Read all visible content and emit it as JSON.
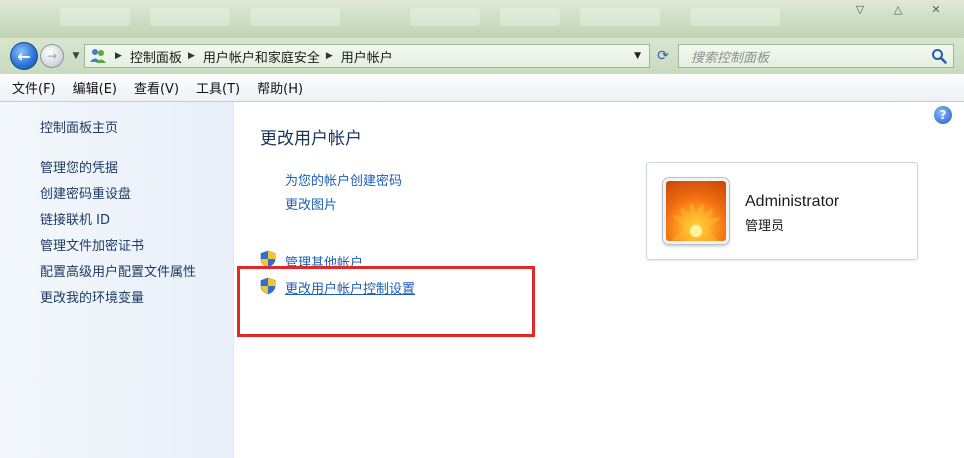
{
  "address_bar": {
    "breadcrumbs": [
      "控制面板",
      "用户帐户和家庭安全",
      "用户帐户"
    ],
    "search_placeholder": "搜索控制面板"
  },
  "menu": {
    "items": [
      "文件(F)",
      "编辑(E)",
      "查看(V)",
      "工具(T)",
      "帮助(H)"
    ]
  },
  "sidebar": {
    "home": "控制面板主页",
    "links": [
      "管理您的凭据",
      "创建密码重设盘",
      "链接联机 ID",
      "管理文件加密证书",
      "配置高级用户配置文件属性",
      "更改我的环境变量"
    ]
  },
  "main": {
    "title": "更改用户帐户",
    "tasks": [
      "为您的帐户创建密码",
      "更改图片"
    ],
    "shield_tasks": [
      "管理其他帐户",
      "更改用户帐户控制设置"
    ]
  },
  "user": {
    "name": "Administrator",
    "role": "管理员"
  },
  "colors": {
    "link": "#1c5fb8",
    "highlight_box": "#e02a2a",
    "title": "#17345a"
  }
}
